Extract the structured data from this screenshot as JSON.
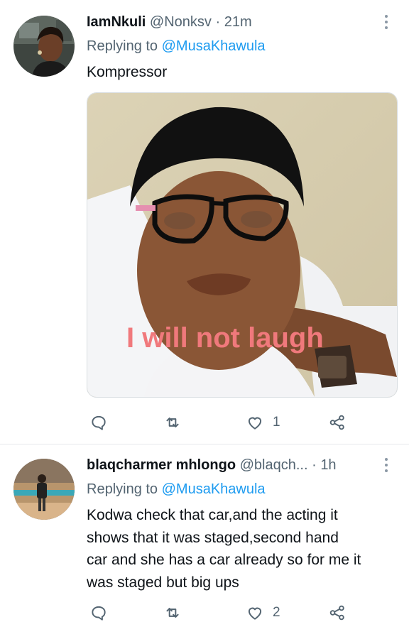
{
  "tweets": [
    {
      "display_name": "IamNkuli",
      "handle": "@Nonksv",
      "separator": "·",
      "time": "21m",
      "replying_prefix": "Replying to",
      "replying_to": "@MusaKhawula",
      "text": "Kompressor",
      "media_caption": "I will not laugh",
      "stats": {
        "reply": "",
        "retweet": "",
        "like": "1"
      }
    },
    {
      "display_name": "blaqcharmer mhlongo",
      "handle": "@blaqch...",
      "separator": "·",
      "time": "1h",
      "replying_prefix": "Replying to",
      "replying_to": "@MusaKhawula",
      "text_lines": [
        "Kodwa check that car,and the acting it",
        "shows that it was staged,second hand",
        "car and she has a car already so for me it",
        "was staged but big ups"
      ],
      "stats": {
        "reply": "",
        "retweet": "",
        "like": "2"
      }
    }
  ],
  "icons": {
    "reply": "reply-icon",
    "retweet": "retweet-icon",
    "like": "heart-icon",
    "share": "share-icon",
    "more": "more-options-icon"
  },
  "colors": {
    "accent": "#1d9bf0",
    "muted": "#536471",
    "text": "#0f1419",
    "meme_caption": "#f0797c"
  }
}
